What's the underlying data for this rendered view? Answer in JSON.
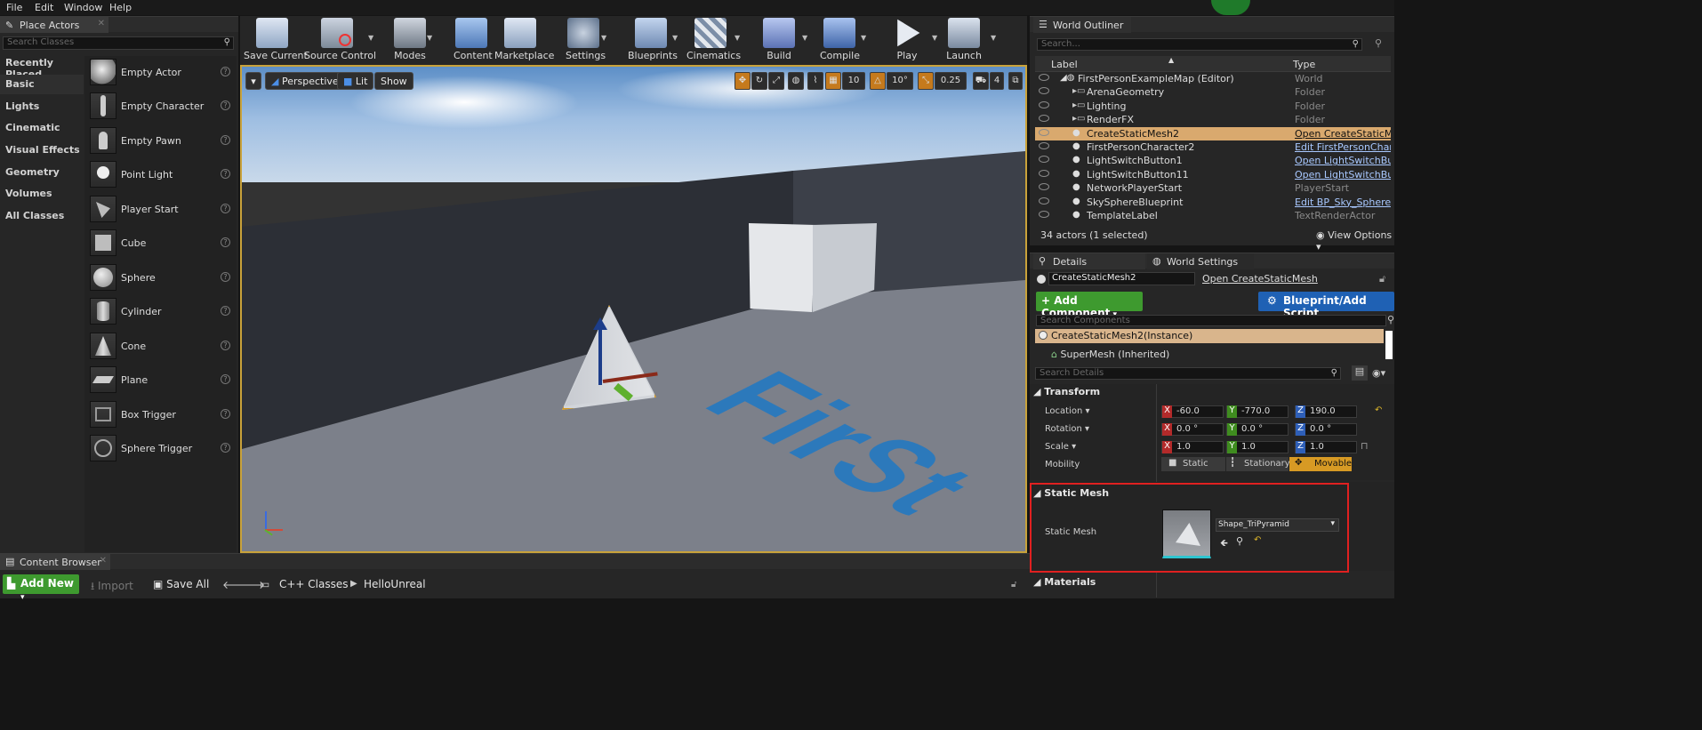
{
  "menu": [
    "File",
    "Edit",
    "Window",
    "Help"
  ],
  "place_actors": {
    "tab_title": "Place Actors",
    "search_placeholder": "Search Classes",
    "categories": [
      "Recently Placed",
      "Basic",
      "Lights",
      "Cinematic",
      "Visual Effects",
      "Geometry",
      "Volumes",
      "All Classes"
    ],
    "active_category": "Basic",
    "actors": [
      "Empty Actor",
      "Empty Character",
      "Empty Pawn",
      "Point Light",
      "Player Start",
      "Cube",
      "Sphere",
      "Cylinder",
      "Cone",
      "Plane",
      "Box Trigger",
      "Sphere Trigger"
    ]
  },
  "toolbar": {
    "buttons": [
      {
        "label": "Save Current",
        "icon": "save-icon"
      },
      {
        "label": "Source Control",
        "icon": "source-control-icon"
      },
      {
        "label": "Modes",
        "icon": "modes-icon"
      },
      {
        "label": "Content",
        "icon": "content-icon"
      },
      {
        "label": "Marketplace",
        "icon": "marketplace-icon"
      },
      {
        "label": "Settings",
        "icon": "settings-icon"
      },
      {
        "label": "Blueprints",
        "icon": "blueprints-icon"
      },
      {
        "label": "Cinematics",
        "icon": "cinematics-icon"
      },
      {
        "label": "Build",
        "icon": "build-icon"
      },
      {
        "label": "Compile",
        "icon": "compile-icon"
      },
      {
        "label": "Play",
        "icon": "play-icon"
      },
      {
        "label": "Launch",
        "icon": "launch-icon"
      }
    ]
  },
  "viewport": {
    "perspective": "Perspective",
    "lit": "Lit",
    "show": "Show",
    "grid_snap": "10",
    "rotation_snap": "10°",
    "scale_snap": "0.25",
    "camera_speed": "4",
    "floor_text": "FirSt",
    "accent": "#c9a23a"
  },
  "outliner": {
    "tab_title": "World Outliner",
    "search_placeholder": "Search...",
    "col_label": "Label",
    "col_type": "Type",
    "rows": [
      {
        "label": "FirstPersonExampleMap (Editor)",
        "type": "World",
        "link": false
      },
      {
        "label": "ArenaGeometry",
        "type": "Folder",
        "link": false
      },
      {
        "label": "Lighting",
        "type": "Folder",
        "link": false
      },
      {
        "label": "RenderFX",
        "type": "Folder",
        "link": false
      },
      {
        "label": "CreateStaticMesh2",
        "type": "Open CreateStaticMesh",
        "link": true
      },
      {
        "label": "FirstPersonCharacter2",
        "type": "Edit FirstPersonCharacter",
        "link": true
      },
      {
        "label": "LightSwitchButton1",
        "type": "Open LightSwitchButton",
        "link": true
      },
      {
        "label": "LightSwitchButton11",
        "type": "Open LightSwitchButton",
        "link": true
      },
      {
        "label": "NetworkPlayerStart",
        "type": "PlayerStart",
        "link": false
      },
      {
        "label": "SkySphereBlueprint",
        "type": "Edit BP_Sky_Sphere",
        "link": true
      },
      {
        "label": "TemplateLabel",
        "type": "TextRenderActor",
        "link": false
      }
    ],
    "selected_index": 4,
    "count_text": "34 actors (1 selected)",
    "view_options": "View Options"
  },
  "details": {
    "tab_details": "Details",
    "tab_world_settings": "World Settings",
    "actor_name": "CreateStaticMesh2",
    "open_link": "Open CreateStaticMesh",
    "add_component": "+ Add Component",
    "blueprint_script": "Blueprint/Add Script",
    "search_components": "Search Components",
    "instance_row": "CreateStaticMesh2(Instance)",
    "component_row": "SuperMesh (Inherited)",
    "search_details": "Search Details",
    "transform": {
      "section": "Transform",
      "location_label": "Location",
      "rotation_label": "Rotation",
      "scale_label": "Scale",
      "mobility_label": "Mobility",
      "location": [
        "-60.0",
        "-770.0",
        "190.0"
      ],
      "rotation": [
        "0.0 °",
        "0.0 °",
        "0.0 °"
      ],
      "scale": [
        "1.0",
        "1.0",
        "1.0"
      ],
      "mobility_options": [
        "Static",
        "Stationary",
        "Movable"
      ],
      "mobility_selected": "Movable"
    },
    "static_mesh": {
      "section": "Static Mesh",
      "label": "Static Mesh",
      "asset": "Shape_TriPyramid"
    },
    "materials_section": "Materials"
  },
  "content_browser": {
    "tab_title": "Content Browser",
    "add_new": "Add New",
    "import": "Import",
    "save_all": "Save All",
    "path": [
      "C++ Classes",
      "HelloUnreal"
    ]
  }
}
